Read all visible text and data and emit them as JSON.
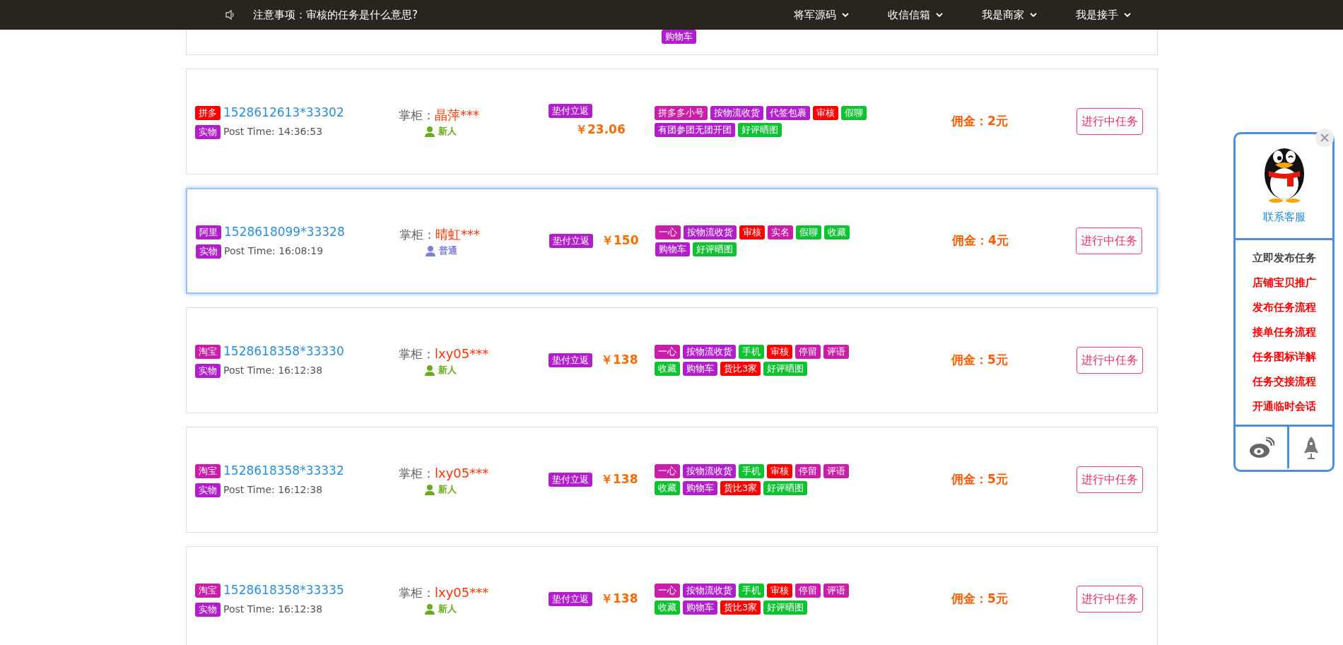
{
  "topbar": {
    "notice": "注意事项：审核的任务是什么意思?",
    "menus": [
      {
        "label": "将军源码"
      },
      {
        "label": "收信信箱"
      },
      {
        "label": "我是商家"
      },
      {
        "label": "我是接手"
      }
    ]
  },
  "partial_row": {
    "tags": [
      {
        "text": "购物车",
        "color": "#b01fc9"
      }
    ]
  },
  "rows": [
    {
      "selected": false,
      "platform": {
        "text": "拼多",
        "color": "#ff0000"
      },
      "task_id": "1528612613*33302",
      "type": {
        "text": "实物",
        "color": "#b01fc9"
      },
      "post_time": "Post Time: 14:36:53",
      "seller_label": "掌柜：",
      "seller": "晶萍***",
      "rank": {
        "text": "新人",
        "color": "#6aaa1e"
      },
      "refund": "垫付立返",
      "price": "￥23.06",
      "tags": [
        {
          "text": "拼多多小号",
          "color": "#c91fa8"
        },
        {
          "text": "按物流收货",
          "color": "#b01fc9"
        },
        {
          "text": "代签包裹",
          "color": "#b01fc9"
        },
        {
          "text": "审核",
          "color": "#ff0000"
        },
        {
          "text": "假聊",
          "color": "#0fc232"
        },
        {
          "text": "有团参团无团开团",
          "color": "#b01fc9"
        },
        {
          "text": "好评晒图",
          "color": "#0fc232"
        }
      ],
      "commission": "佣金：2元",
      "action": "进行中任务"
    },
    {
      "selected": true,
      "platform": {
        "text": "阿里",
        "color": "#b01fc9"
      },
      "task_id": "1528618099*33328",
      "type": {
        "text": "实物",
        "color": "#b01fc9"
      },
      "post_time": "Post Time: 16:08:19",
      "seller_label": "掌柜：",
      "seller": "晴虹***",
      "rank": {
        "text": "普通",
        "color": "#7c80d8"
      },
      "refund": "垫付立返",
      "price": "￥150",
      "tags": [
        {
          "text": "一心",
          "color": "#c91fa8"
        },
        {
          "text": "按物流收货",
          "color": "#b01fc9"
        },
        {
          "text": "审核",
          "color": "#ff0000"
        },
        {
          "text": "实名",
          "color": "#c91fa8"
        },
        {
          "text": "假聊",
          "color": "#0fc232"
        },
        {
          "text": "收藏",
          "color": "#0fc232"
        },
        {
          "text": "购物车",
          "color": "#b01fc9"
        },
        {
          "text": "好评晒图",
          "color": "#0fc232"
        }
      ],
      "commission": "佣金：4元",
      "action": "进行中任务"
    },
    {
      "selected": false,
      "platform": {
        "text": "淘宝",
        "color": "#c91fa8"
      },
      "task_id": "1528618358*33330",
      "type": {
        "text": "实物",
        "color": "#b01fc9"
      },
      "post_time": "Post Time: 16:12:38",
      "seller_label": "掌柜：",
      "seller": "lxy05***",
      "rank": {
        "text": "新人",
        "color": "#6aaa1e"
      },
      "refund": "垫付立返",
      "price": "￥138",
      "tags": [
        {
          "text": "一心",
          "color": "#c91fa8"
        },
        {
          "text": "按物流收货",
          "color": "#b01fc9"
        },
        {
          "text": "手机",
          "color": "#0fc232"
        },
        {
          "text": "审核",
          "color": "#ff0000"
        },
        {
          "text": "停留",
          "color": "#c91fa8"
        },
        {
          "text": "评语",
          "color": "#c91fa8"
        },
        {
          "text": "收藏",
          "color": "#0fc232"
        },
        {
          "text": "购物车",
          "color": "#b01fc9"
        },
        {
          "text": "货比3家",
          "color": "#ff0000"
        },
        {
          "text": "好评晒图",
          "color": "#0fc232"
        }
      ],
      "commission": "佣金：5元",
      "action": "进行中任务"
    },
    {
      "selected": false,
      "platform": {
        "text": "淘宝",
        "color": "#c91fa8"
      },
      "task_id": "1528618358*33332",
      "type": {
        "text": "实物",
        "color": "#b01fc9"
      },
      "post_time": "Post Time: 16:12:38",
      "seller_label": "掌柜：",
      "seller": "lxy05***",
      "rank": {
        "text": "新人",
        "color": "#6aaa1e"
      },
      "refund": "垫付立返",
      "price": "￥138",
      "tags": [
        {
          "text": "一心",
          "color": "#c91fa8"
        },
        {
          "text": "按物流收货",
          "color": "#b01fc9"
        },
        {
          "text": "手机",
          "color": "#0fc232"
        },
        {
          "text": "审核",
          "color": "#ff0000"
        },
        {
          "text": "停留",
          "color": "#c91fa8"
        },
        {
          "text": "评语",
          "color": "#c91fa8"
        },
        {
          "text": "收藏",
          "color": "#0fc232"
        },
        {
          "text": "购物车",
          "color": "#b01fc9"
        },
        {
          "text": "货比3家",
          "color": "#ff0000"
        },
        {
          "text": "好评晒图",
          "color": "#0fc232"
        }
      ],
      "commission": "佣金：5元",
      "action": "进行中任务"
    },
    {
      "selected": false,
      "platform": {
        "text": "淘宝",
        "color": "#c91fa8"
      },
      "task_id": "1528618358*33335",
      "type": {
        "text": "实物",
        "color": "#b01fc9"
      },
      "post_time": "Post Time: 16:12:38",
      "seller_label": "掌柜：",
      "seller": "lxy05***",
      "rank": {
        "text": "新人",
        "color": "#6aaa1e"
      },
      "refund": "垫付立返",
      "price": "￥138",
      "tags": [
        {
          "text": "一心",
          "color": "#c91fa8"
        },
        {
          "text": "按物流收货",
          "color": "#b01fc9"
        },
        {
          "text": "手机",
          "color": "#0fc232"
        },
        {
          "text": "审核",
          "color": "#ff0000"
        },
        {
          "text": "停留",
          "color": "#c91fa8"
        },
        {
          "text": "评语",
          "color": "#c91fa8"
        },
        {
          "text": "收藏",
          "color": "#0fc232"
        },
        {
          "text": "购物车",
          "color": "#b01fc9"
        },
        {
          "text": "货比3家",
          "color": "#ff0000"
        },
        {
          "text": "好评晒图",
          "color": "#0fc232"
        }
      ],
      "commission": "佣金：5元",
      "action": "进行中任务"
    }
  ],
  "side_panel": {
    "contact": "联系客服",
    "links": [
      {
        "text": "立即发布任务",
        "color": "#444444"
      },
      {
        "text": "店铺宝贝推广",
        "color": "#ff0000"
      },
      {
        "text": "发布任务流程",
        "color": "#ff0000"
      },
      {
        "text": "接单任务流程",
        "color": "#ff0000"
      },
      {
        "text": "任务图标详解",
        "color": "#ff0000"
      },
      {
        "text": "任务交接流程",
        "color": "#ff0000"
      },
      {
        "text": "开通临时会话",
        "color": "#ff0000"
      }
    ]
  }
}
